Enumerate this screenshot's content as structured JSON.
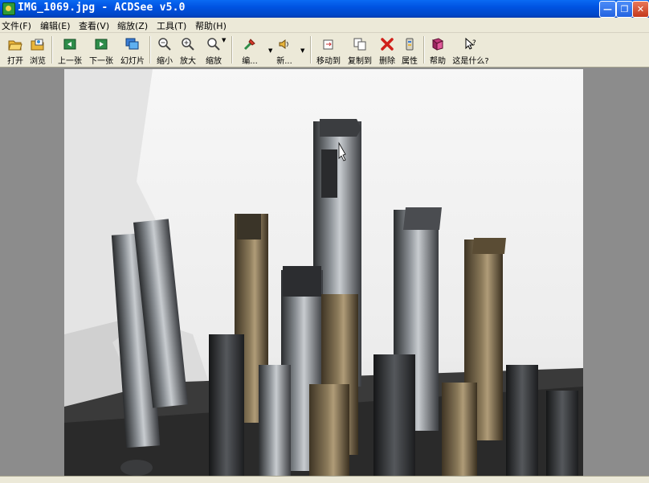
{
  "window": {
    "title": "IMG_1069.jpg - ACDSee v5.0"
  },
  "menu": [
    {
      "label": "文件(F)"
    },
    {
      "label": "编辑(E)"
    },
    {
      "label": "查看(V)"
    },
    {
      "label": "缩放(Z)"
    },
    {
      "label": "工具(T)"
    },
    {
      "label": "帮助(H)"
    }
  ],
  "toolbar": {
    "open": "打开",
    "browse": "浏览",
    "prev": "上一张",
    "next": "下一张",
    "slideshow": "幻灯片",
    "zoom_out": "缩小",
    "zoom_in": "放大",
    "zoom": "缩放",
    "edit": "编...",
    "sound": "新...",
    "move_to": "移动到",
    "copy_to": "复制到",
    "delete": "删除",
    "properties": "属性",
    "help": "帮助",
    "whats_this": "这是什么?"
  },
  "colors": {
    "titlebar": "#0053e1",
    "chrome": "#ece9d8",
    "viewer_bg": "#8c8c8c"
  }
}
